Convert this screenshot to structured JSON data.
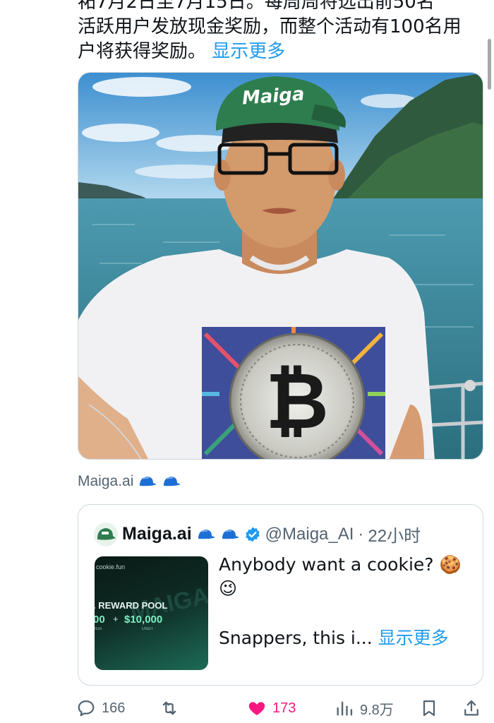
{
  "tweet": {
    "text_top": "祏7月2日至7月15日。每周周将选出前50名",
    "text_line2": "活跃用户发放现金奖励，而整个活动有100名用",
    "text_line3": "户将获得奖励。",
    "show_more": "显示更多"
  },
  "media": {
    "cap_text": "Maiga",
    "credit": "Maiga.ai"
  },
  "quote": {
    "name": "Maiga.ai",
    "handle": "@Maiga_AI",
    "separator": "·",
    "time": "22小时",
    "text_line1": "Anybody want a cookie? 🍪",
    "text_line2": "😉",
    "text_line3": "Snappers, this i...",
    "show_more": "显示更多",
    "thumb": {
      "site": "cookie.fun",
      "title": ". REWARD POOL",
      "amount_left": "00",
      "plus": "+",
      "amount": "$10,000",
      "sub_left": "IGA",
      "sub_right": "USDT",
      "watermark": "MAIGA"
    }
  },
  "actions": {
    "replies": "166",
    "likes": "173",
    "views": "9.8万"
  },
  "colors": {
    "accent": "#1d9bf0",
    "like": "#f91880",
    "muted": "#536471",
    "cap_green": "#2e7d4f"
  }
}
